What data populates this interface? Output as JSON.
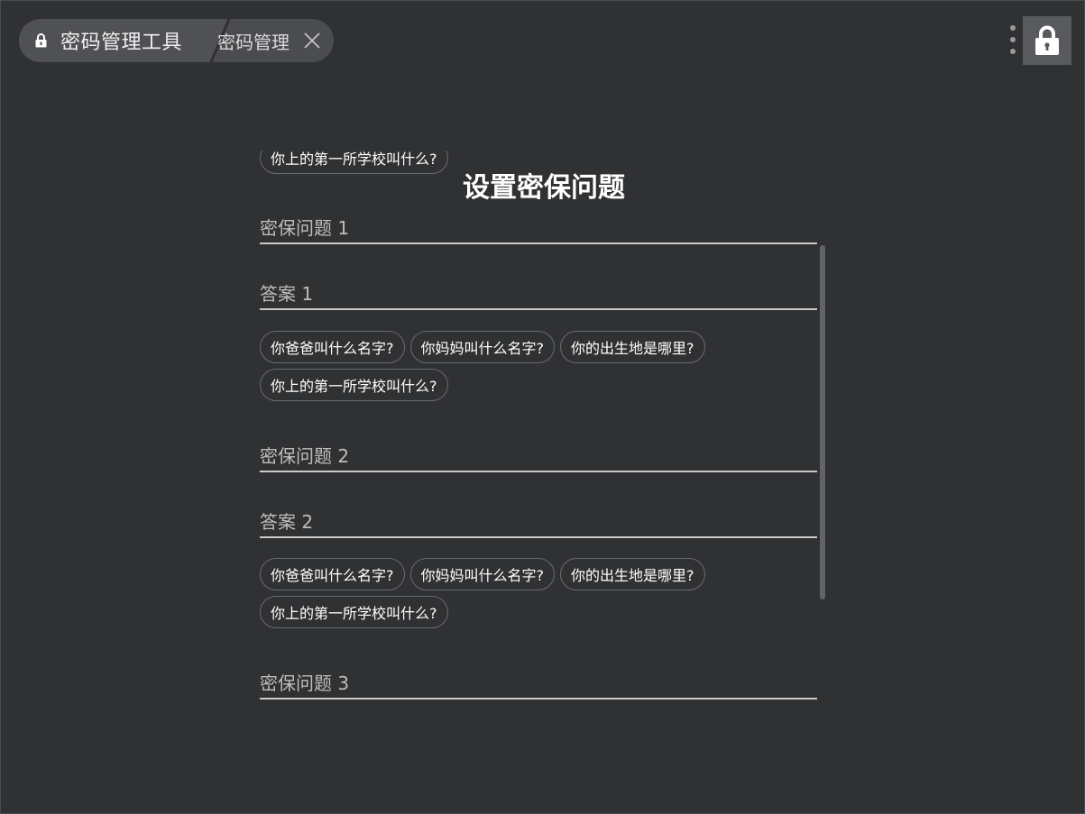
{
  "header": {
    "app_title": "密码管理工具",
    "page_tab_title": "密码管理"
  },
  "form": {
    "title": "设置密保问题",
    "ghost_chip": "你上的第一所学校叫什么?",
    "groups": [
      {
        "question_label": "密保问题 1",
        "answer_label": "答案 1",
        "suggestions": [
          "你爸爸叫什么名字?",
          "你妈妈叫什么名字?",
          "你的出生地是哪里?",
          "你上的第一所学校叫什么?"
        ]
      },
      {
        "question_label": "密保问题 2",
        "answer_label": "答案 2",
        "suggestions": [
          "你爸爸叫什么名字?",
          "你妈妈叫什么名字?",
          "你的出生地是哪里?",
          "你上的第一所学校叫什么?"
        ]
      },
      {
        "question_label": "密保问题 3"
      }
    ]
  },
  "icons": {
    "app": "lock-icon",
    "close": "close-icon",
    "menu": "more-vertical-icon",
    "lock_button": "lock-icon"
  },
  "colors": {
    "background": "#303133",
    "tab_background": "#4b4c4f",
    "field_underline": "#c9c9c9",
    "lock_button_background": "#595a5d"
  }
}
